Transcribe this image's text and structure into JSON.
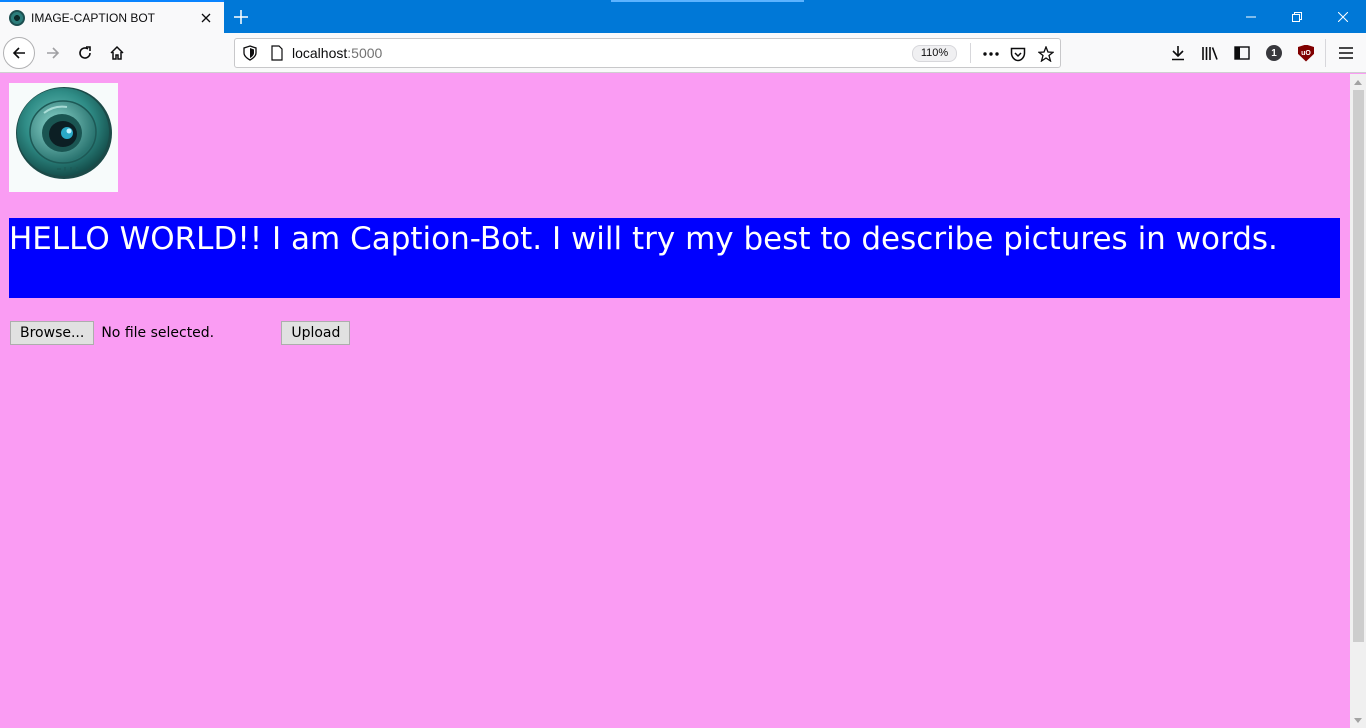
{
  "browser": {
    "tab_title": "IMAGE-CAPTION BOT",
    "url_host": "localhost",
    "url_port": ":5000",
    "zoom": "110%",
    "notification_count": "1",
    "ublock_label": "uO"
  },
  "page": {
    "heading": "HELLO WORLD!! I am Caption-Bot. I will try my best to describe pictures in words.",
    "browse_label": "Browse...",
    "file_status": "No file selected.",
    "upload_label": "Upload",
    "background_color": "#fa9cf3",
    "banner_color": "#0000ff"
  }
}
